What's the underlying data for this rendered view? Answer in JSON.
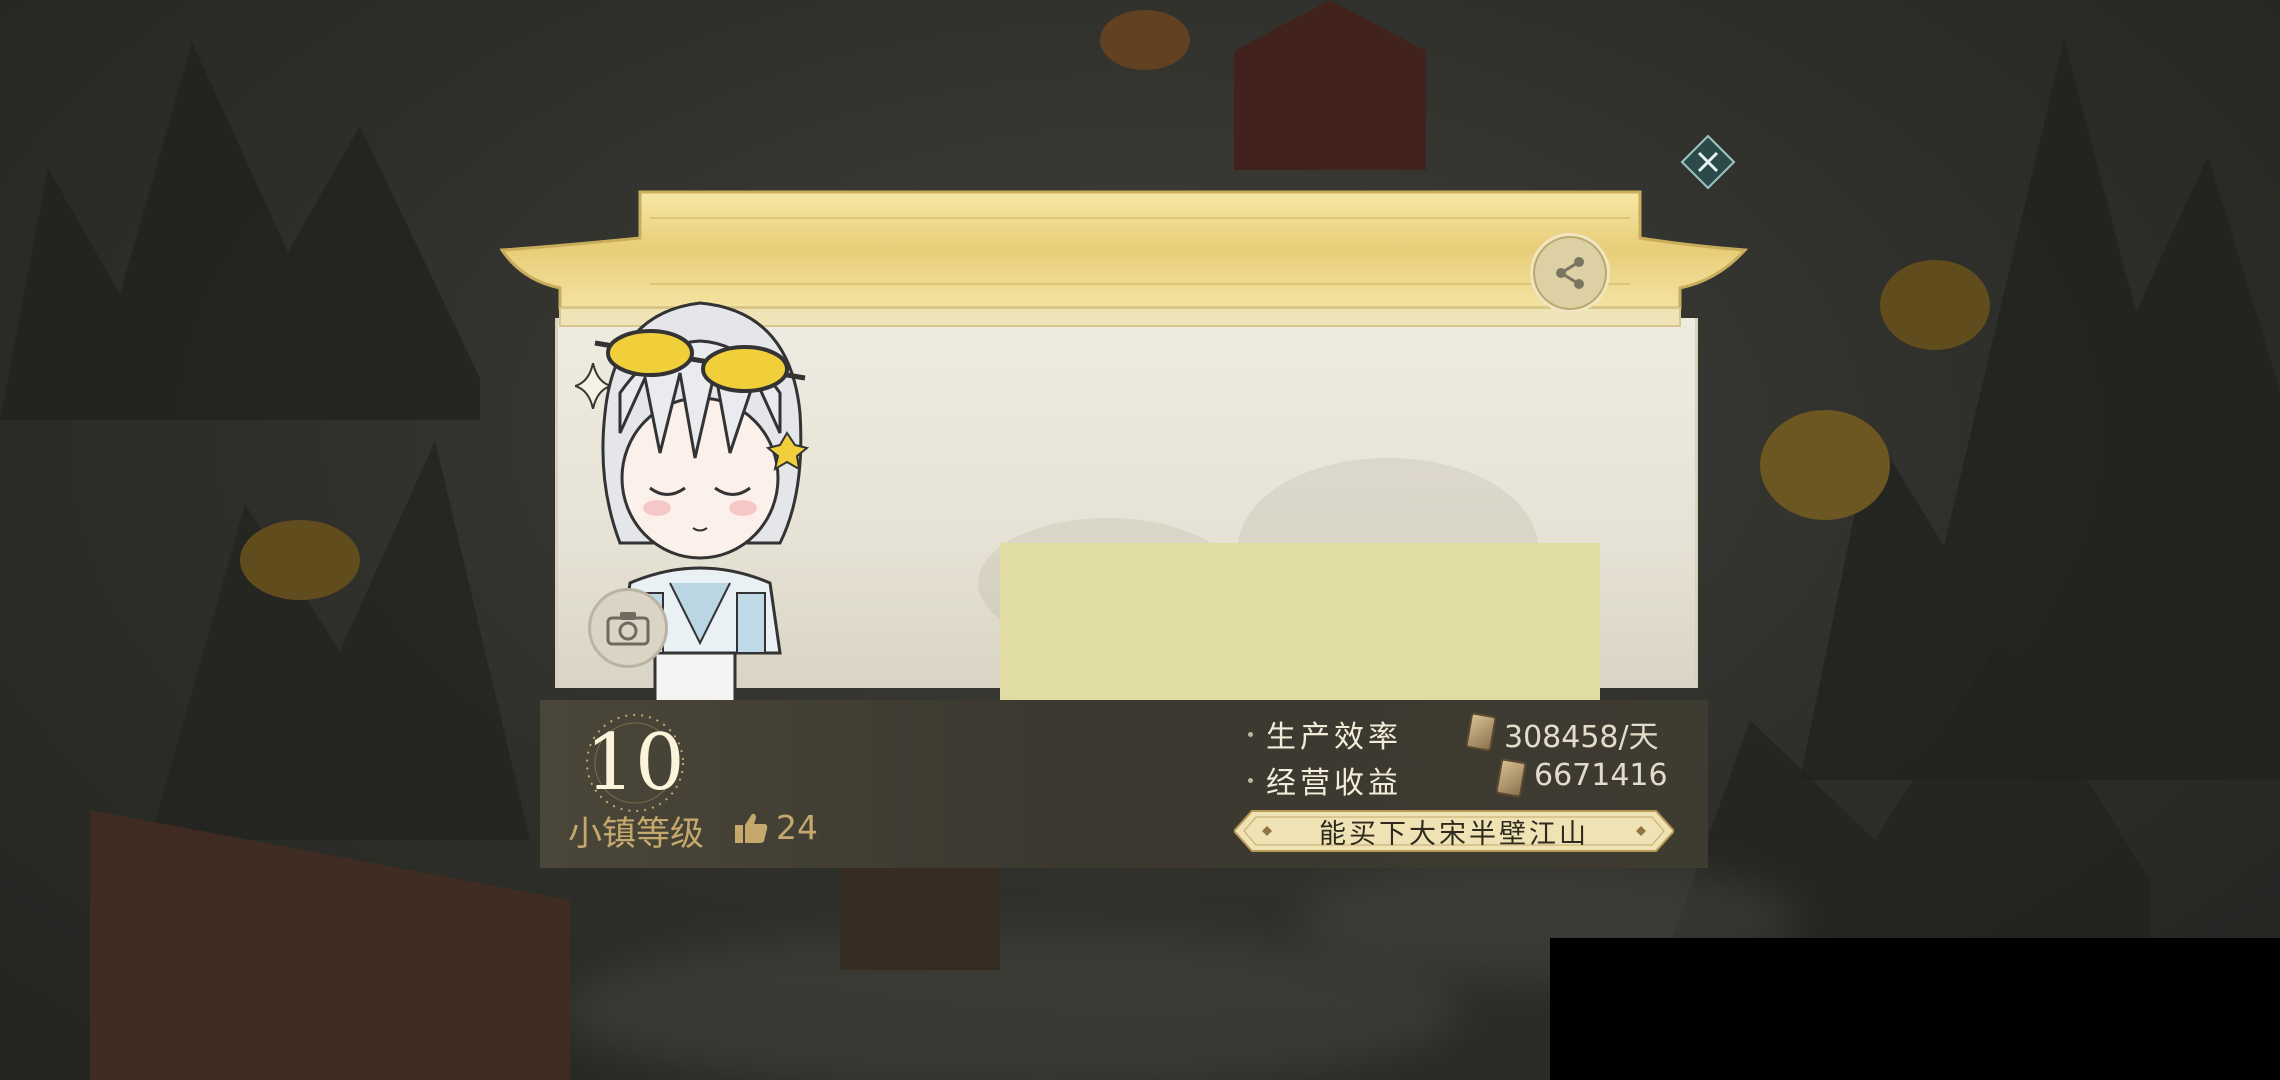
{
  "panel": {
    "level": "10",
    "level_label": "小镇等级",
    "likes": "24",
    "stats": [
      {
        "label": "生产效率",
        "value": "308458/天"
      },
      {
        "label": "经营收益",
        "value": "6671416"
      }
    ],
    "banner": "能买下大宋半壁江山"
  },
  "colors": {
    "gold": "#e8c96a",
    "bar": "#3b3830",
    "banner": "#efe3b5",
    "placeholder": "#e1dba4"
  },
  "icons": {
    "share": "share-icon",
    "camera": "camera-icon",
    "close": "close-icon",
    "like": "thumbs-up-icon",
    "currency": "scroll-icon"
  }
}
